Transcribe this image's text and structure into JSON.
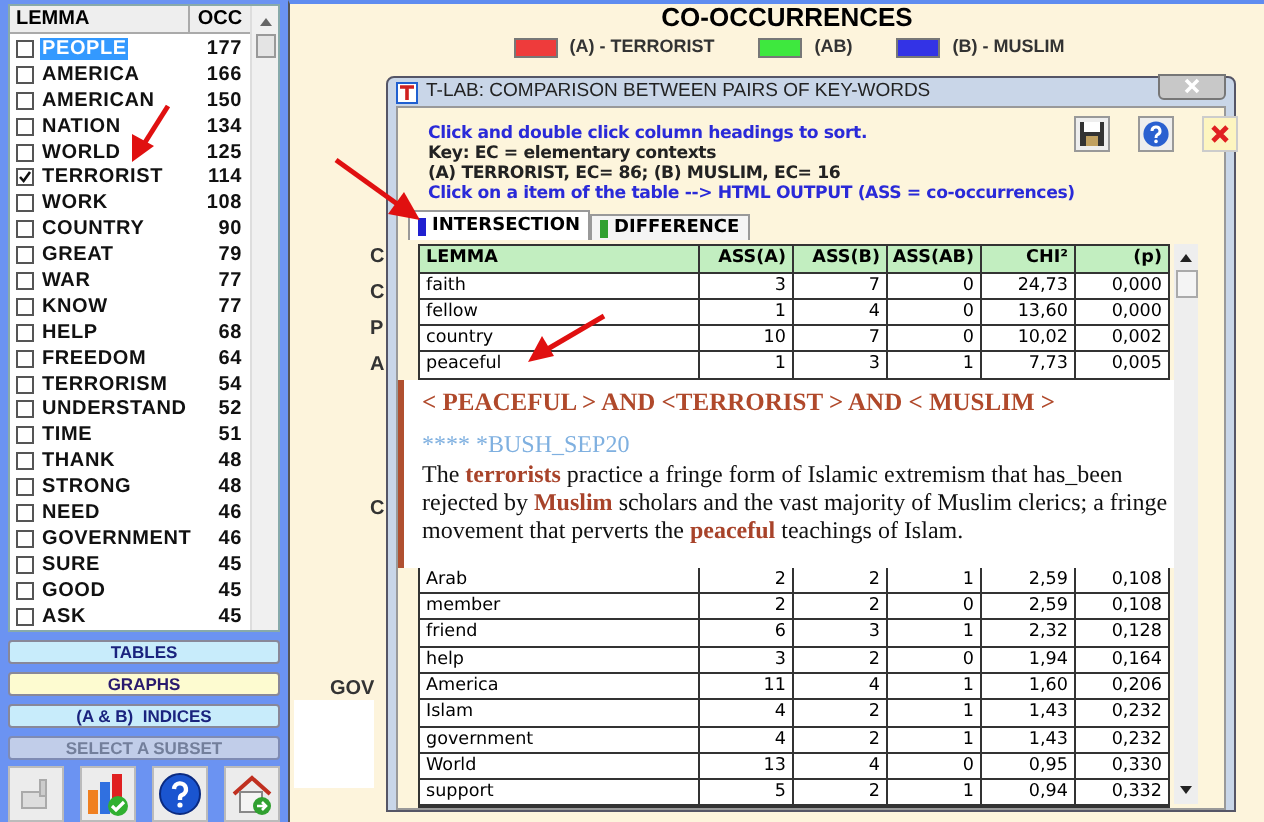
{
  "lemma_list": {
    "columns": [
      "LEMMA",
      "OCC"
    ],
    "rows": [
      {
        "lemma": "PEOPLE",
        "occ": "177",
        "checked": false,
        "selected": true
      },
      {
        "lemma": "AMERICA",
        "occ": "166",
        "checked": false,
        "selected": false
      },
      {
        "lemma": "AMERICAN",
        "occ": "150",
        "checked": false,
        "selected": false
      },
      {
        "lemma": "NATION",
        "occ": "134",
        "checked": false,
        "selected": false
      },
      {
        "lemma": "WORLD",
        "occ": "125",
        "checked": false,
        "selected": false
      },
      {
        "lemma": "TERRORIST",
        "occ": "114",
        "checked": true,
        "selected": false
      },
      {
        "lemma": "WORK",
        "occ": "108",
        "checked": false,
        "selected": false
      },
      {
        "lemma": "COUNTRY",
        "occ": "90",
        "checked": false,
        "selected": false
      },
      {
        "lemma": "GREAT",
        "occ": "79",
        "checked": false,
        "selected": false
      },
      {
        "lemma": "WAR",
        "occ": "77",
        "checked": false,
        "selected": false
      },
      {
        "lemma": "KNOW",
        "occ": "77",
        "checked": false,
        "selected": false
      },
      {
        "lemma": "HELP",
        "occ": "68",
        "checked": false,
        "selected": false
      },
      {
        "lemma": "FREEDOM",
        "occ": "64",
        "checked": false,
        "selected": false
      },
      {
        "lemma": "TERRORISM",
        "occ": "54",
        "checked": false,
        "selected": false
      },
      {
        "lemma": "UNDERSTAND",
        "occ": "52",
        "checked": false,
        "selected": false
      },
      {
        "lemma": "TIME",
        "occ": "51",
        "checked": false,
        "selected": false
      },
      {
        "lemma": "THANK",
        "occ": "48",
        "checked": false,
        "selected": false
      },
      {
        "lemma": "STRONG",
        "occ": "48",
        "checked": false,
        "selected": false
      },
      {
        "lemma": "NEED",
        "occ": "46",
        "checked": false,
        "selected": false
      },
      {
        "lemma": "GOVERNMENT",
        "occ": "46",
        "checked": false,
        "selected": false
      },
      {
        "lemma": "SURE",
        "occ": "45",
        "checked": false,
        "selected": false
      },
      {
        "lemma": "GOOD",
        "occ": "45",
        "checked": false,
        "selected": false
      },
      {
        "lemma": "ASK",
        "occ": "45",
        "checked": false,
        "selected": false
      }
    ]
  },
  "side_buttons": [
    {
      "label": "TABLES",
      "kind": "blue",
      "disabled": false
    },
    {
      "label": "GRAPHS",
      "kind": "yellow",
      "disabled": false
    },
    {
      "label": "(A & B)  INDICES",
      "kind": "blue",
      "disabled": false
    },
    {
      "label": "SELECT A SUBSET",
      "kind": "gray",
      "disabled": true
    }
  ],
  "main": {
    "title": "CO-OCCURRENCES",
    "legend": [
      {
        "label": "(A) - TERRORIST",
        "color": "#ee3b3b"
      },
      {
        "label": "(AB)",
        "color": "#3ee83e"
      },
      {
        "label": "(B) - MUSLIM",
        "color": "#3333e6"
      }
    ],
    "background_labels": [
      "C",
      "C",
      "P",
      "A",
      "C",
      "GOV"
    ]
  },
  "dialog": {
    "title": "T-LAB: COMPARISON BETWEEN PAIRS OF KEY-WORDS",
    "notes": [
      {
        "text": "Click and double click column headings to sort.",
        "kind": "hint"
      },
      {
        "text": "Key: EC = elementary contexts",
        "kind": "info"
      },
      {
        "text": "(A) TERRORIST, EC= 86; (B) MUSLIM, EC= 16",
        "kind": "info"
      },
      {
        "text": "Click on a item of the table --> HTML OUTPUT (ASS = co-occurrences)",
        "kind": "hint"
      }
    ],
    "tabs": [
      {
        "label": "INTERSECTION",
        "selected": true,
        "color": "#2020d0"
      },
      {
        "label": "DIFFERENCE",
        "selected": false,
        "color": "#30a030"
      }
    ],
    "table": {
      "columns": [
        "LEMMA",
        "ASS(A)",
        "ASS(B)",
        "ASS(AB)",
        "CHI²",
        "(p)"
      ],
      "rows": [
        [
          "faith",
          "3",
          "7",
          "0",
          "24,73",
          "0,000"
        ],
        [
          "fellow",
          "1",
          "4",
          "0",
          "13,60",
          "0,000"
        ],
        [
          "country",
          "10",
          "7",
          "0",
          "10,02",
          "0,002"
        ],
        [
          "peaceful",
          "1",
          "3",
          "1",
          "7,73",
          "0,005"
        ]
      ]
    },
    "popup": {
      "heading": "< PEACEFUL > AND <TERRORIST > AND < MUSLIM >",
      "source": "**** *BUSH_SEP20",
      "text": "The **terrorists** practice a fringe form of Islamic extremism that has_been rejected by **Muslim** scholars and the vast majority of Muslim clerics; a fringe movement that perverts the **peaceful** teachings of Islam."
    },
    "table_lower_rows": [
      [
        "Arab",
        "2",
        "2",
        "1",
        "2,59",
        "0,108"
      ],
      [
        "member",
        "2",
        "2",
        "0",
        "2,59",
        "0,108"
      ],
      [
        "friend",
        "6",
        "3",
        "1",
        "2,32",
        "0,128"
      ],
      [
        "help",
        "3",
        "2",
        "0",
        "1,94",
        "0,164"
      ],
      [
        "America",
        "11",
        "4",
        "1",
        "1,60",
        "0,206"
      ],
      [
        "Islam",
        "4",
        "2",
        "1",
        "1,43",
        "0,232"
      ],
      [
        "government",
        "4",
        "2",
        "1",
        "1,43",
        "0,232"
      ],
      [
        "World",
        "13",
        "4",
        "0",
        "0,95",
        "0,330"
      ],
      [
        "support",
        "5",
        "2",
        "1",
        "0,94",
        "0,332"
      ]
    ]
  }
}
